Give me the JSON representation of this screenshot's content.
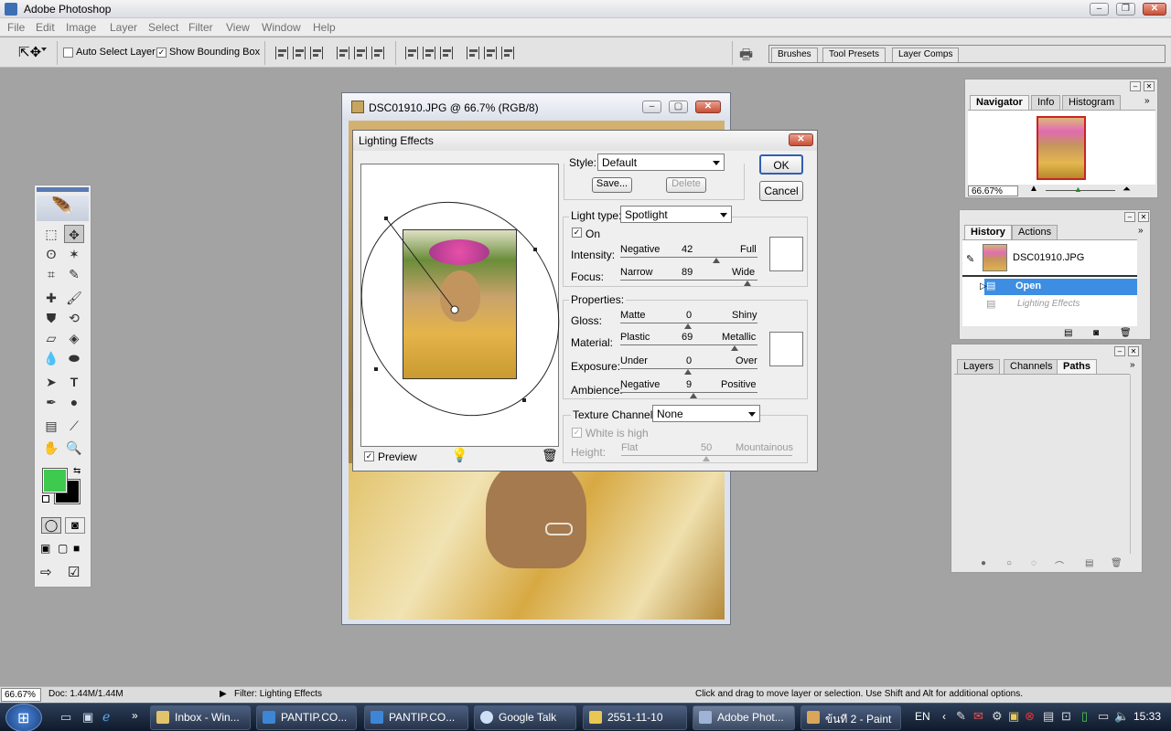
{
  "app": {
    "title": "Adobe Photoshop"
  },
  "menu": [
    "File",
    "Edit",
    "Image",
    "Layer",
    "Select",
    "Filter",
    "View",
    "Window",
    "Help"
  ],
  "options": {
    "auto_select_layer": "Auto Select Layer",
    "show_bounding_box": "Show Bounding Box"
  },
  "well_tabs": [
    "Brushes",
    "Tool Presets",
    "Layer Comps"
  ],
  "document": {
    "title": "DSC01910.JPG @ 66.7% (RGB/8)"
  },
  "dialog": {
    "title": "Lighting Effects",
    "style_label": "Style:",
    "style_value": "Default",
    "save": "Save...",
    "delete": "Delete",
    "ok": "OK",
    "cancel": "Cancel",
    "light_type_label": "Light type:",
    "light_type_value": "Spotlight",
    "on": "On",
    "intensity": {
      "label": "Intensity:",
      "left": "Negative",
      "value": "42",
      "right": "Full"
    },
    "focus": {
      "label": "Focus:",
      "left": "Narrow",
      "value": "89",
      "right": "Wide"
    },
    "properties_label": "Properties:",
    "gloss": {
      "label": "Gloss:",
      "left": "Matte",
      "value": "0",
      "right": "Shiny"
    },
    "material": {
      "label": "Material:",
      "left": "Plastic",
      "value": "69",
      "right": "Metallic"
    },
    "exposure": {
      "label": "Exposure:",
      "left": "Under",
      "value": "0",
      "right": "Over"
    },
    "ambience": {
      "label": "Ambience:",
      "left": "Negative",
      "value": "9",
      "right": "Positive"
    },
    "texture_label": "Texture Channel:",
    "texture_value": "None",
    "white_is_high": "White is high",
    "height": {
      "label": "Height:",
      "left": "Flat",
      "value": "50",
      "right": "Mountainous"
    },
    "preview": "Preview"
  },
  "navigator": {
    "tabs": [
      "Navigator",
      "Info",
      "Histogram"
    ],
    "zoom": "66.67%"
  },
  "history": {
    "tabs": [
      "History",
      "Actions"
    ],
    "snapshot": "DSC01910.JPG",
    "states": [
      "Open",
      "Lighting Effects"
    ]
  },
  "layers": {
    "tabs": [
      "Layers",
      "Channels",
      "Paths"
    ]
  },
  "status": {
    "zoom": "66.67%",
    "doc": "Doc: 1.44M/1.44M",
    "filter": "Filter: Lighting Effects",
    "hint": "Click and drag to move layer or selection.  Use Shift and Alt for additional options."
  },
  "taskbar": {
    "items": [
      "Inbox - Win...",
      "PANTIP.CO...",
      "PANTIP.CO...",
      "Google Talk",
      "2551-11-10",
      "Adobe Phot...",
      "ข้นที 2 - Paint"
    ],
    "lang": "EN",
    "clock": "15:33"
  },
  "colors": {
    "foreground": "#3ec94f",
    "background": "#000000",
    "selection": "#3d8ee3"
  }
}
